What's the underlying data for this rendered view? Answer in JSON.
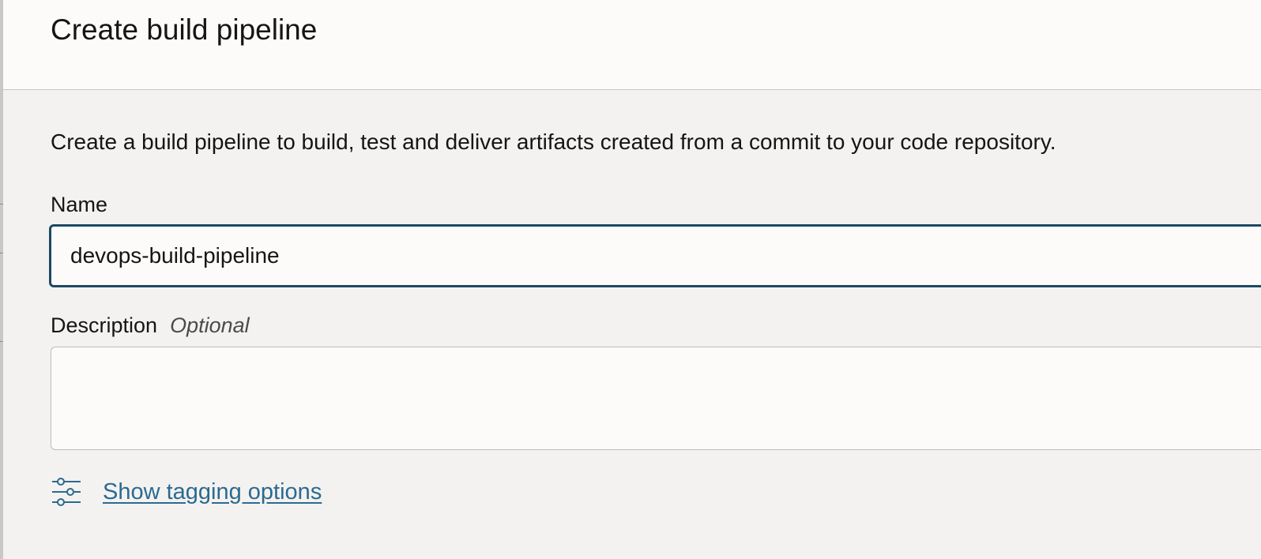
{
  "panel": {
    "title": "Create build pipeline",
    "intro": "Create a build pipeline to build, test and deliver artifacts created from a commit to your code repository."
  },
  "form": {
    "name": {
      "label": "Name",
      "value": "devops-build-pipeline"
    },
    "description": {
      "label": "Description",
      "optional_label": "Optional",
      "value": ""
    },
    "tagging": {
      "icon": "sliders-icon",
      "link_label": "Show tagging options"
    }
  },
  "colors": {
    "link": "#2b6a8f",
    "focus_border": "#1c4a63",
    "body_bg": "#f3f2f1",
    "header_bg": "#fcfbfa"
  }
}
